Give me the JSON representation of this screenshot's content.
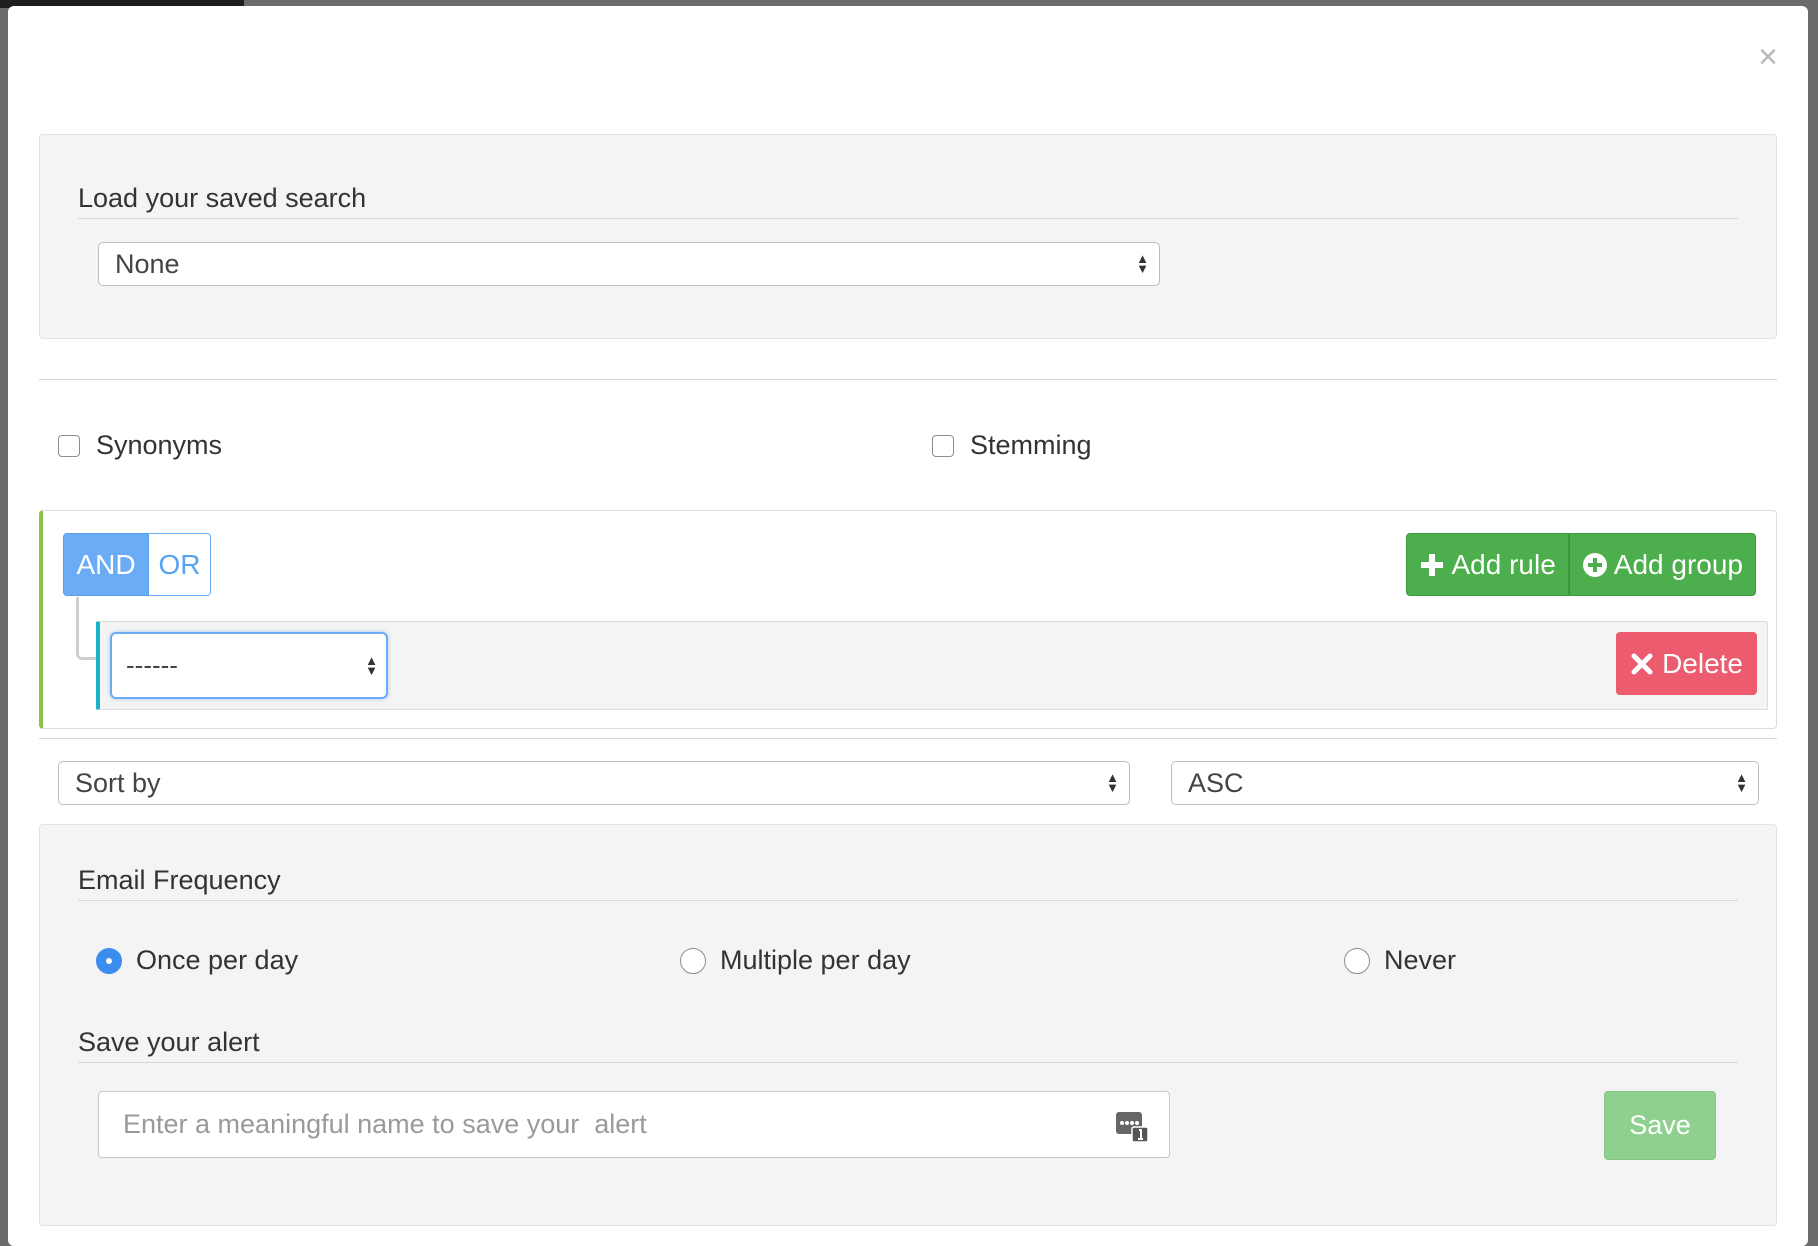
{
  "modal": {
    "close_symbol": "×"
  },
  "saved_search": {
    "title": "Load your saved search",
    "selected": "None"
  },
  "options": {
    "synonyms_label": "Synonyms",
    "stemming_label": "Stemming"
  },
  "builder": {
    "and_label": "AND",
    "or_label": "OR",
    "add_rule_label": "Add rule",
    "add_group_label": "Add group",
    "rule_field_selected": "------",
    "delete_label": "Delete"
  },
  "sort": {
    "field_selected": "Sort by",
    "order_selected": "ASC"
  },
  "email": {
    "title": "Email Frequency",
    "options": [
      "Once per day",
      "Multiple per day",
      "Never"
    ],
    "selected": "Once per day"
  },
  "alert": {
    "title": "Save your alert",
    "placeholder": "Enter a meaningful name to save your  alert",
    "save_label": "Save"
  },
  "colors": {
    "and_active": "#6aacf6",
    "green_button": "#4cae4c",
    "delete_button": "#ec5b6e",
    "save_button": "#8fd08f",
    "radio_checked": "#3c8df0",
    "builder_accent": "#8bc34a",
    "rule_accent": "#1ab2c9"
  }
}
